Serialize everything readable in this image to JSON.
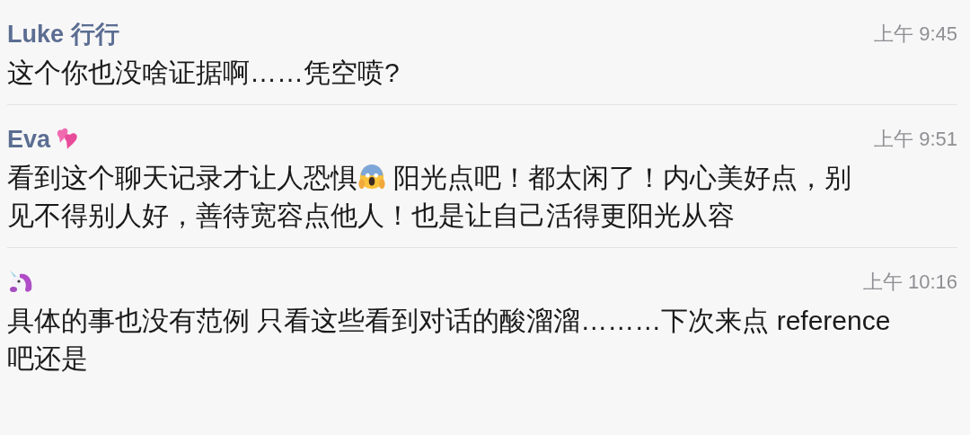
{
  "comments": [
    {
      "kind": "plain",
      "author": "Luke 行行",
      "time": "上午 9:45",
      "segments": [
        {
          "kind": "text",
          "text": "这个你也没啥证据啊……凭空喷?"
        }
      ]
    },
    {
      "kind": "hearts",
      "author": "Eva",
      "time": "上午 9:51",
      "segments": [
        {
          "kind": "text",
          "text": "看到这个聊天记录才让人恐惧"
        },
        {
          "kind": "scream"
        },
        {
          "kind": "text",
          "text": " 阳光点吧！都太闲了！内心美好点，别"
        },
        {
          "kind": "break"
        },
        {
          "kind": "text",
          "text": "见不得别人好，善待宽容点他人！也是让自己活得更阳光从容"
        }
      ]
    },
    {
      "kind": "unicorn",
      "time": "上午 10:16",
      "segments": [
        {
          "kind": "text",
          "text": "具体的事也没有范例 只看这些看到对话的酸溜溜………下次来点 reference"
        },
        {
          "kind": "break"
        },
        {
          "kind": "text",
          "text": "吧还是"
        }
      ]
    }
  ]
}
